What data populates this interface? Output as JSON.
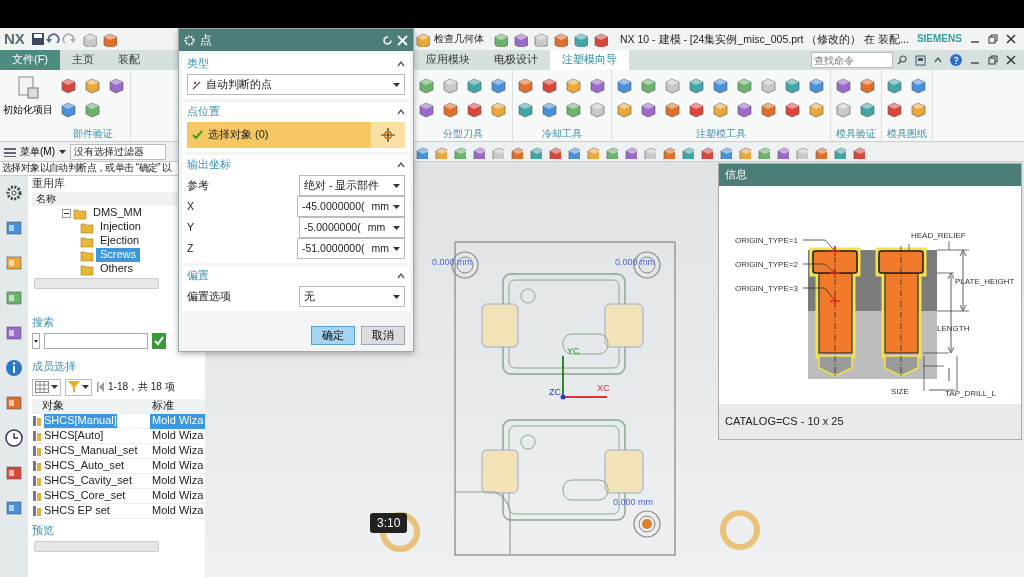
{
  "title_bar": {
    "logo": "NX",
    "command": "检查几何体",
    "title": "NX 10 - 建模 - [24集实例_misc_005.prt （修改的） 在 装配...",
    "brand": "SIEMENS"
  },
  "menu_tabs": [
    {
      "label": "文件(F)",
      "kind": "file",
      "selected": false
    },
    {
      "label": "主页",
      "kind": "tab",
      "selected": false
    },
    {
      "label": "装配",
      "kind": "tab",
      "selected": false
    },
    {
      "label": "应用模块",
      "kind": "tab",
      "selected": false
    },
    {
      "label": "电极设计",
      "kind": "tab",
      "selected": false
    },
    {
      "label": "注塑模向导",
      "kind": "tab",
      "selected": true
    }
  ],
  "command_search": {
    "placeholder": "查找命令"
  },
  "ribbon": {
    "init_button": "初始化项目",
    "groups": [
      {
        "label": "部件验证"
      },
      {
        "label": "分型刀具"
      },
      {
        "label": "冷却工具"
      },
      {
        "label": "注塑模工具"
      },
      {
        "label": "模具验证"
      },
      {
        "label": "模具图纸"
      }
    ]
  },
  "command_bar": {
    "menu": "菜单(M)",
    "filter": "没有选择过滤器"
  },
  "status_message": "选择对象以自动判断点，或单击 “确定” 以",
  "reuse_library": {
    "title": "重用库",
    "tree_header": "名称",
    "tree": [
      {
        "label": "DMS_MM",
        "expanded": true,
        "selected": false,
        "children": [
          {
            "label": "Injection",
            "selected": false
          },
          {
            "label": "Ejection",
            "selected": false
          },
          {
            "label": "Screws",
            "selected": true
          },
          {
            "label": "Others",
            "selected": false
          }
        ]
      }
    ],
    "search_label": "搜索",
    "member_label": "成员选择",
    "page_info": "1-18，共 18 项",
    "columns": [
      "对象",
      "标准"
    ],
    "rows": [
      {
        "object": "SHCS[Manual]",
        "standard": "Mold Wiza",
        "selected": true
      },
      {
        "object": "SHCS[Auto]",
        "standard": "Mold Wiza",
        "selected": false
      },
      {
        "object": "SHCS_Manual_set",
        "standard": "Mold Wiza",
        "selected": false
      },
      {
        "object": "SHCS_Auto_set",
        "standard": "Mold Wiza",
        "selected": false
      },
      {
        "object": "SHCS_Cavity_set",
        "standard": "Mold Wiza",
        "selected": false
      },
      {
        "object": "SHCS_Core_set",
        "standard": "Mold Wiza",
        "selected": false
      },
      {
        "object": "SHCS EP set",
        "standard": "Mold Wiza",
        "selected": false
      }
    ],
    "preview_label": "预览"
  },
  "point_dialog": {
    "title": "点",
    "sections": [
      {
        "title": "类型",
        "expanded": true,
        "kind": "type",
        "value": "自动判断的点"
      },
      {
        "title": "点位置",
        "expanded": true,
        "kind": "select",
        "value": "选择对象 (0)"
      },
      {
        "title": "输出坐标",
        "expanded": true,
        "kind": "coords",
        "reference_label": "参考",
        "reference": "绝对 - 显示部件",
        "coords": [
          {
            "axis": "X",
            "value": "-45.0000000(",
            "unit": "mm"
          },
          {
            "axis": "Y",
            "value": "-5.0000000(",
            "unit": "mm"
          },
          {
            "axis": "Z",
            "value": "-51.0000000(",
            "unit": "mm"
          }
        ]
      },
      {
        "title": "偏置",
        "expanded": true,
        "kind": "offset",
        "label": "偏置选项",
        "value": "无"
      }
    ],
    "buttons": [
      {
        "label": "确定",
        "kind": "primary"
      },
      {
        "label": "取消",
        "kind": "secondary"
      }
    ]
  },
  "viewport": {
    "dimension_labels": [
      "0.000 mm",
      "0.000 mm",
      "0.000 mm"
    ],
    "axes": [
      "XC",
      "YC",
      "ZC"
    ]
  },
  "info_panel": {
    "title": "信息",
    "labels": [
      "ORIGIN_TYPE=1",
      "ORIGIN_TYPE=2",
      "ORIGIN_TYPE=3",
      "HEAD_RELIEF",
      "PLATE_HEIGHT",
      "LENGTH",
      "SIZE",
      "TAP_DRILL_L"
    ],
    "catalog": "CATALOG=CS - 10 x 25"
  },
  "video_time": "3:10"
}
